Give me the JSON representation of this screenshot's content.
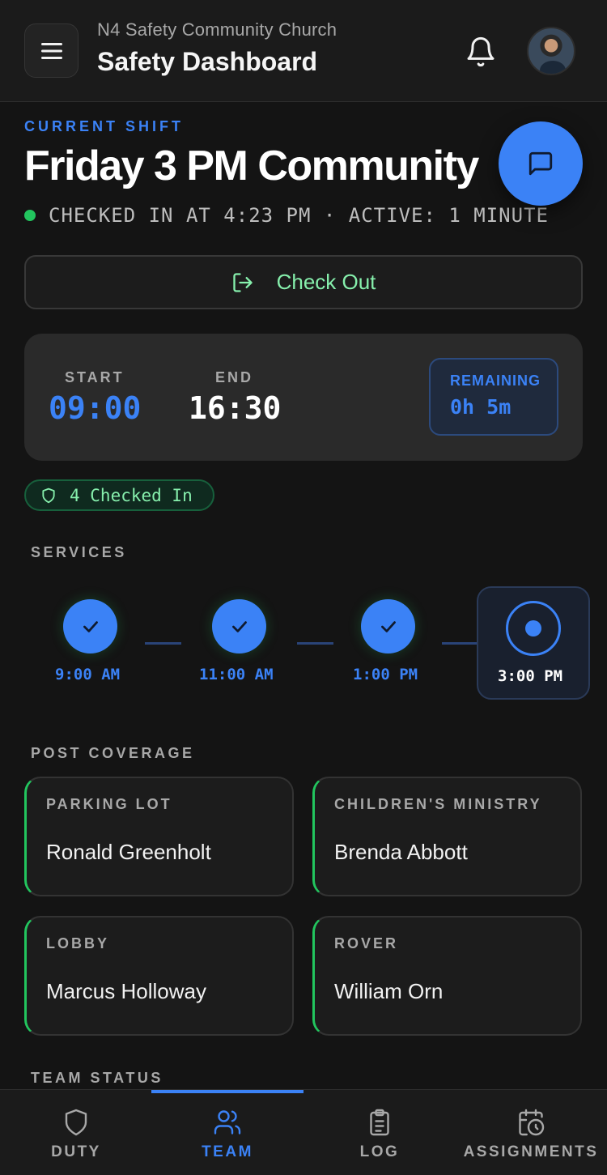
{
  "header": {
    "org_name": "N4 Safety Community Church",
    "title": "Safety Dashboard",
    "menu_icon": "hamburger-icon",
    "notification_icon": "bell-icon"
  },
  "current_shift": {
    "label": "CURRENT SHIFT",
    "title": "Friday 3 PM Community",
    "status": "CHECKED IN AT 4:23 PM · ACTIVE: 1 MINUTE",
    "checkout_label": "Check Out"
  },
  "schedule": {
    "start_label": "START",
    "start_value": "09:00",
    "end_label": "END",
    "end_value": "16:30",
    "remaining_label": "REMAINING",
    "remaining_value": "0h 5m"
  },
  "checked_in": {
    "label": "4 Checked In"
  },
  "services": {
    "label": "SERVICES",
    "items": [
      {
        "time": "9:00 AM",
        "state": "done"
      },
      {
        "time": "11:00 AM",
        "state": "done"
      },
      {
        "time": "1:00 PM",
        "state": "done"
      },
      {
        "time": "3:00 PM",
        "state": "current"
      }
    ]
  },
  "post_coverage": {
    "label": "POST COVERAGE",
    "posts": [
      {
        "name": "PARKING LOT",
        "person": "Ronald Greenholt"
      },
      {
        "name": "CHILDREN'S MINISTRY",
        "person": "Brenda Abbott"
      },
      {
        "name": "LOBBY",
        "person": "Marcus Holloway"
      },
      {
        "name": "ROVER",
        "person": "William Orn"
      }
    ]
  },
  "team_status": {
    "label": "TEAM STATUS"
  },
  "bottom_nav": {
    "items": [
      {
        "label": "DUTY",
        "icon": "shield-icon"
      },
      {
        "label": "TEAM",
        "icon": "users-icon"
      },
      {
        "label": "LOG",
        "icon": "clipboard-icon"
      },
      {
        "label": "ASSIGNMENTS",
        "icon": "calendar-clock-icon"
      }
    ],
    "active": "TEAM"
  },
  "colors": {
    "accent": "#3b82f6",
    "success": "#22c55e",
    "success_text": "#86efac",
    "background": "#141414"
  }
}
